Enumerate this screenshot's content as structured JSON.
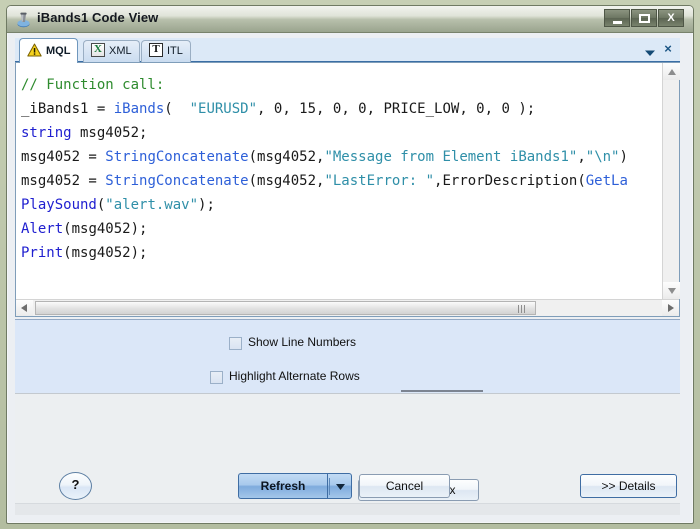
{
  "window": {
    "title": "iBands1 Code View",
    "icon": "app-icon",
    "controls": {
      "minimize": "minimize-icon",
      "maximize": "maximize-icon",
      "close": "X"
    }
  },
  "tabs": {
    "items": [
      {
        "label": "MQL",
        "icon": "warning-triangle-icon",
        "active": true
      },
      {
        "label": "XML",
        "icon": "xml-document-icon",
        "active": false
      },
      {
        "label": "ITL",
        "icon": "text-document-icon",
        "active": false
      }
    ],
    "overflow_icon": "chevron-down-icon",
    "close_label": "×"
  },
  "code": {
    "language": "MQL",
    "lines": [
      {
        "segments": [
          {
            "text": "// Function call:",
            "cls": "c-comment"
          }
        ]
      },
      {
        "segments": [
          {
            "text": "_iBands1 = ",
            "cls": "c-plain"
          },
          {
            "text": "iBands",
            "cls": "c-fn"
          },
          {
            "text": "(  ",
            "cls": "c-plain"
          },
          {
            "text": "\"EURUSD\"",
            "cls": "c-str"
          },
          {
            "text": ", 0, 15, 0, 0, PRICE_LOW, 0, 0 );",
            "cls": "c-plain"
          }
        ]
      },
      {
        "segments": [
          {
            "text": "string",
            "cls": "c-kw"
          },
          {
            "text": " msg4052;",
            "cls": "c-plain"
          }
        ]
      },
      {
        "segments": [
          {
            "text": "msg4052 = ",
            "cls": "c-plain"
          },
          {
            "text": "StringConcatenate",
            "cls": "c-fn"
          },
          {
            "text": "(msg4052,",
            "cls": "c-plain"
          },
          {
            "text": "\"Message from Element iBands1\"",
            "cls": "c-str"
          },
          {
            "text": ",",
            "cls": "c-plain"
          },
          {
            "text": "\"\\n\"",
            "cls": "c-str"
          },
          {
            "text": ")",
            "cls": "c-plain"
          }
        ]
      },
      {
        "segments": [
          {
            "text": "msg4052 = ",
            "cls": "c-plain"
          },
          {
            "text": "StringConcatenate",
            "cls": "c-fn"
          },
          {
            "text": "(msg4052,",
            "cls": "c-plain"
          },
          {
            "text": "\"LastError: \"",
            "cls": "c-str"
          },
          {
            "text": ",ErrorDescription(",
            "cls": "c-plain"
          },
          {
            "text": "GetLa",
            "cls": "c-fn"
          }
        ]
      },
      {
        "segments": [
          {
            "text": "PlaySound",
            "cls": "c-kw"
          },
          {
            "text": "(",
            "cls": "c-plain"
          },
          {
            "text": "\"alert.wav\"",
            "cls": "c-str"
          },
          {
            "text": ");",
            "cls": "c-plain"
          }
        ]
      },
      {
        "segments": [
          {
            "text": "Alert",
            "cls": "c-kw"
          },
          {
            "text": "(msg4052);",
            "cls": "c-plain"
          }
        ]
      },
      {
        "segments": [
          {
            "text": "Print",
            "cls": "c-kw"
          },
          {
            "text": "(msg4052);",
            "cls": "c-plain"
          }
        ]
      }
    ]
  },
  "options": {
    "show_line_numbers": {
      "label": "Show Line Numbers",
      "checked": false
    },
    "highlight_alternate_rows": {
      "label": "Highlight Alternate Rows",
      "checked": false
    },
    "check_syntax_label": "Check Syntax"
  },
  "footer": {
    "help_label": "?",
    "refresh_label": "Refresh",
    "refresh_dropdown_icon": "chevron-down-icon",
    "cancel_label": "Cancel",
    "details_label": ">> Details"
  },
  "colors": {
    "title_bar": "#b8c0ac",
    "tab_active": "#ffffff",
    "tab_strip": "#dce9f7",
    "options_panel": "#dbe7f8",
    "default_button": "#7fabdd",
    "comment": "#2e8b2e",
    "keyword": "#2020d0",
    "string": "#2f8fa8",
    "function": "#2d5fd8"
  }
}
